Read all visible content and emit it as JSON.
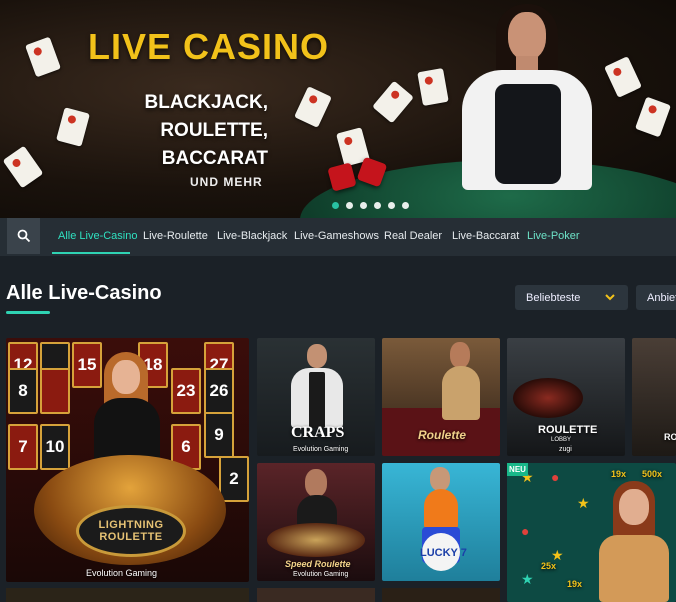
{
  "hero": {
    "title": "LIVE CASINO",
    "line1": "BLACKJACK,",
    "line2": "ROULETTE,",
    "line3": "BACCARAT",
    "more": "UND MEHR",
    "slides": 6,
    "active_slide": 0
  },
  "nav": {
    "items": [
      {
        "label": "Alle Live-Casino",
        "state": "active"
      },
      {
        "label": "Live-Roulette"
      },
      {
        "label": "Live-Blackjack"
      },
      {
        "label": "Live-Gameshows"
      },
      {
        "label": "Real Dealer"
      },
      {
        "label": "Live-Baccarat"
      },
      {
        "label": "Live-Poker",
        "state": "accent"
      }
    ]
  },
  "section": {
    "title": "Alle Live-Casino",
    "sort_label": "Beliebteste",
    "provider_label": "Anbieter"
  },
  "tiles": {
    "lightning": {
      "name_line1": "LIGHTNING",
      "name_line2": "ROULETTE",
      "provider": "Evolution Gaming",
      "numbers": [
        "12",
        "15",
        "18",
        "27",
        "8",
        "23",
        "26",
        "9",
        "7",
        "10",
        "6",
        "2"
      ]
    },
    "craps": {
      "name": "CRAPS",
      "provider": "Evolution Gaming"
    },
    "roulette": {
      "name": "Roulette"
    },
    "roulette_lobby": {
      "name": "ROULETTE",
      "sub": "LOBBY",
      "provider": "zugi"
    },
    "partial": {
      "name": "RO"
    },
    "speed": {
      "name": "Speed Roulette",
      "provider": "Evolution Gaming"
    },
    "lucky": {
      "name": "LUCKY 7"
    },
    "neu": {
      "badge": "NEU",
      "labels": [
        "19x",
        "500x",
        "25x",
        "19x"
      ]
    }
  },
  "colors": {
    "accent": "#2fd3b3",
    "gold": "#f2c21a"
  }
}
